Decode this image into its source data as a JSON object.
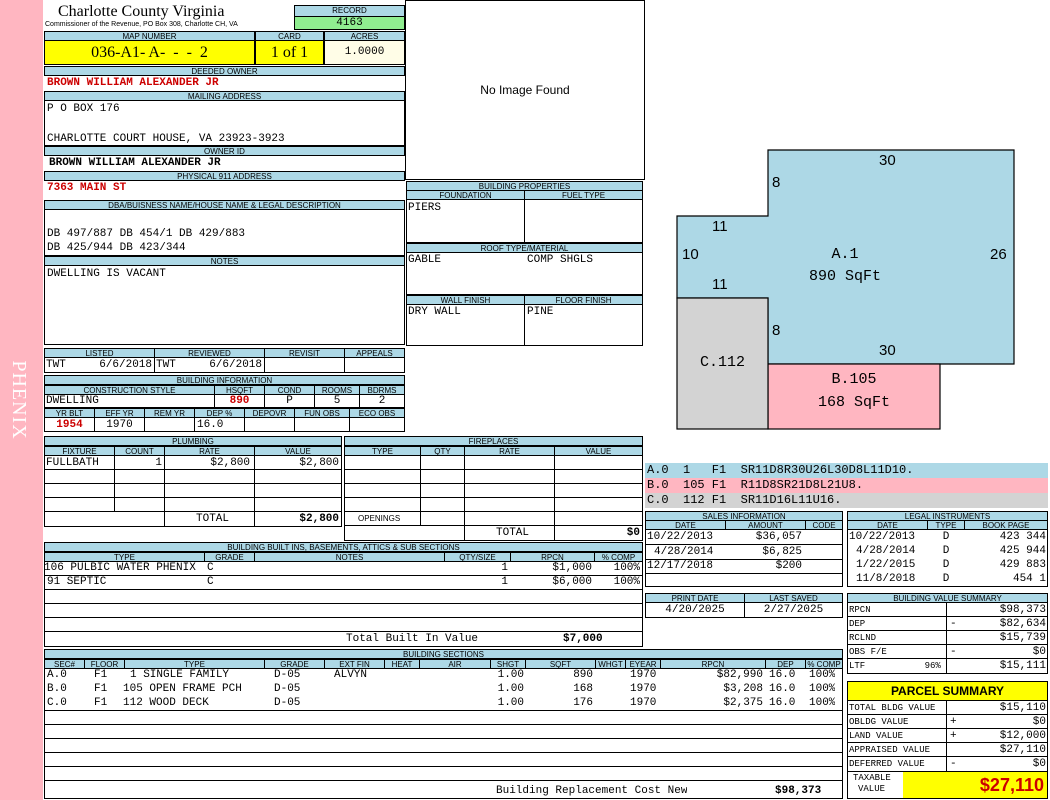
{
  "county": {
    "name": "Charlotte County Virginia",
    "office": "Commissioner of the Revenue, PO Box 308, Charlotte CH, VA"
  },
  "record": {
    "label": "RECORD",
    "value": "4163"
  },
  "map": {
    "label": "MAP NUMBER",
    "value": "036-A1- A-  -  -  2"
  },
  "card": {
    "label": "CARD",
    "value": "1 of 1"
  },
  "acres": {
    "label": "ACRES",
    "value": "1.0000"
  },
  "owner": {
    "label": "DEEDED OWNER",
    "value": "BROWN WILLIAM ALEXANDER JR"
  },
  "mailing": {
    "label": "MAILING ADDRESS",
    "line1": "P O BOX 176",
    "line2": "",
    "line3": "CHARLOTTE COURT HOUSE, VA 23923-3923"
  },
  "owner_id": {
    "label": "OWNER ID",
    "value": "BROWN WILLIAM ALEXANDER JR"
  },
  "physical": {
    "label": "PHYSICAL 911 ADDRESS",
    "value": "7363 MAIN ST"
  },
  "legal": {
    "label": "DBA/BUISNESS NAME/HOUSE NAME & LEGAL DESCRIPTION",
    "line1": "DB 497/887 DB 454/1 DB 429/883",
    "line2": "DB 425/944 DB 423/344"
  },
  "notes": {
    "label": "NOTES",
    "value": "DWELLING IS VACANT"
  },
  "image": {
    "text": "No Image Found"
  },
  "side_label": "PHENIX",
  "bldg_props": {
    "label": "BUILDING PROPERTIES",
    "foundation_label": "FOUNDATION",
    "fuel_label": "FUEL TYPE",
    "foundation": "PIERS",
    "fuel": "",
    "roof_label": "ROOF TYPE/MATERIAL",
    "roof_type": "GABLE",
    "roof_material": "COMP SHGLS",
    "wall_label": "WALL FINISH",
    "floor_label": "FLOOR FINISH",
    "wall": "DRY WALL",
    "floor": "PINE"
  },
  "review": {
    "listed_label": "LISTED",
    "reviewed_label": "REVIEWED",
    "revisit_label": "REVISIT",
    "appeals_label": "APPEALS",
    "listed_by": "TWT",
    "listed_date": "6/6/2018",
    "reviewed_by": "TWT",
    "reviewed_date": "6/6/2018",
    "revisit": "",
    "appeals": ""
  },
  "bldg_info": {
    "label": "BUILDING INFORMATION",
    "style_label": "CONSTRUCTION STYLE",
    "hsqft_label": "HSQFT",
    "cond_label": "COND",
    "rooms_label": "ROOMS",
    "bdrms_label": "BDRMS",
    "style": "DWELLING",
    "hsqft": "890",
    "cond": "P",
    "rooms": "5",
    "bdrms": "2",
    "yrblt_label": "YR BLT",
    "effyr_label": "EFF YR",
    "remyr_label": "REM YR",
    "dep_label": "DEP %",
    "depovr_label": "DEPOVR",
    "funobs_label": "FUN OBS",
    "ecoobs_label": "ECO OBS",
    "yrblt": "1954",
    "effyr": "1970",
    "remyr": "",
    "dep": "16.0",
    "depovr": "",
    "funobs": "",
    "ecoobs": ""
  },
  "plumbing": {
    "label": "PLUMBING",
    "headers": [
      "FIXTURE",
      "COUNT",
      "RATE",
      "VALUE"
    ],
    "rows": [
      [
        "FULLBATH",
        "1",
        "$2,800",
        "$2,800"
      ]
    ],
    "total_label": "TOTAL",
    "total": "$2,800"
  },
  "fireplaces": {
    "label": "FIREPLACES",
    "headers": [
      "TYPE",
      "QTY",
      "RATE",
      "VALUE"
    ],
    "openings_label": "OPENINGS",
    "total_label": "TOTAL",
    "total": "$0"
  },
  "built_ins": {
    "label": "BUILDING BUILT INS, BASEMENTS, ATTICS & SUB SECTIONS",
    "headers": [
      "TYPE",
      "GRADE",
      "NOTES",
      "QTY/SIZE",
      "RPCN",
      "% COMP"
    ],
    "rows": [
      [
        "106 PULBIC WATER PHENIX",
        "C",
        "",
        "1",
        "$1,000",
        "100%"
      ],
      [
        "91 SEPTIC",
        "C",
        "",
        "1",
        "$6,000",
        "100%"
      ]
    ],
    "total_label": "Total Built In Value",
    "total": "$7,000"
  },
  "sketch": {
    "sections": [
      {
        "label": "A.1",
        "area": "890 SqFt",
        "color": "#add8e6"
      },
      {
        "label": "B.105",
        "area": "168 SqFt",
        "color": "#ffb6c1"
      },
      {
        "label": "C.112",
        "area": "",
        "color": "#d3d3d3"
      }
    ],
    "dims": [
      "30",
      "8",
      "11",
      "10",
      "11",
      "26",
      "8",
      "30"
    ]
  },
  "sketch_codes": [
    {
      "text": "A.0  1   F1  SR11D8R30U26L30D8L11D10.",
      "color": "#add8e6"
    },
    {
      "text": "B.0  105 F1  R11D8SR21D8L21U8.",
      "color": "#ffb6c1"
    },
    {
      "text": "C.0  112 F1  SR11D16L11U16.",
      "color": "#d3d3d3"
    }
  ],
  "sales": {
    "label": "SALES INFORMATION",
    "headers": [
      "DATE",
      "AMOUNT",
      "CODE"
    ],
    "rows": [
      [
        "10/22/2013",
        "$36,057",
        ""
      ],
      [
        "4/28/2014",
        "$6,825",
        ""
      ],
      [
        "12/17/2018",
        "$200",
        ""
      ]
    ]
  },
  "legal_instruments": {
    "label": "LEGAL INSTRUMENTS",
    "headers": [
      "DATE",
      "TYPE",
      "BOOK PAGE"
    ],
    "rows": [
      [
        "10/22/2013",
        "D",
        "423 344"
      ],
      [
        "4/28/2014",
        "D",
        "425 944"
      ],
      [
        "1/22/2015",
        "D",
        "429 883"
      ],
      [
        "11/8/2018",
        "D",
        "454 1"
      ]
    ]
  },
  "print": {
    "print_label": "PRINT DATE",
    "saved_label": "LAST SAVED",
    "print_date": "4/20/2025",
    "last_saved": "2/27/2025"
  },
  "bvs": {
    "label": "BUILDING VALUE SUMMARY",
    "rows": [
      {
        "l": "RPCN",
        "s": "",
        "v": "$98,373"
      },
      {
        "l": "DEP",
        "s": "-",
        "v": "$82,634"
      },
      {
        "l": "RCLND",
        "s": "",
        "v": "$15,739"
      },
      {
        "l": "OBS F/E",
        "s": "-",
        "v": "$0"
      },
      {
        "l": "LTF           96%",
        "s": "",
        "v": "$15,111"
      }
    ]
  },
  "parcel": {
    "label": "PARCEL SUMMARY",
    "rows": [
      {
        "l": "TOTAL BLDG VALUE",
        "s": "",
        "v": "$15,110"
      },
      {
        "l": "OBLDG VALUE",
        "s": "+",
        "v": "$0"
      },
      {
        "l": "LAND VALUE",
        "s": "+",
        "v": "$12,000"
      },
      {
        "l": "APPRAISED VALUE",
        "s": "",
        "v": "$27,110"
      },
      {
        "l": "DEFERRED VALUE",
        "s": "-",
        "v": "$0"
      }
    ],
    "taxable_label1": "TAXABLE",
    "taxable_label2": "VALUE",
    "taxable": "$27,110"
  },
  "sections": {
    "label": "BUILDING SECTIONS",
    "headers": [
      "SEC#",
      "FLOOR",
      "TYPE",
      "GRADE",
      "EXT FIN",
      "HEAT",
      "AIR",
      "SHGT",
      "SQFT",
      "WHGT",
      "EYEAR",
      "RPCN",
      "DEP",
      "% COMP"
    ],
    "rows": [
      [
        "A.0",
        "F1",
        "1 SINGLE FAMILY",
        "D-05",
        "ALVYN",
        "",
        "",
        "1.00",
        "890",
        "",
        "1970",
        "$82,990",
        "16.0",
        "100%"
      ],
      [
        "B.0",
        "F1",
        "105 OPEN FRAME PCH",
        "D-05",
        "",
        "",
        "",
        "1.00",
        "168",
        "",
        "1970",
        "$3,208",
        "16.0",
        "100%"
      ],
      [
        "C.0",
        "F1",
        "112 WOOD DECK",
        "D-05",
        "",
        "",
        "",
        "1.00",
        "176",
        "",
        "1970",
        "$2,375",
        "16.0",
        "100%"
      ]
    ],
    "replacement_label": "Building Replacement Cost New",
    "replacement": "$98,373"
  },
  "colors": {
    "header": "#add8e6",
    "pink": "#ffb6c1",
    "yellow": "#ffff00",
    "green": "#90ee90",
    "gray": "#d3d3d3",
    "red": "#cc0000"
  }
}
